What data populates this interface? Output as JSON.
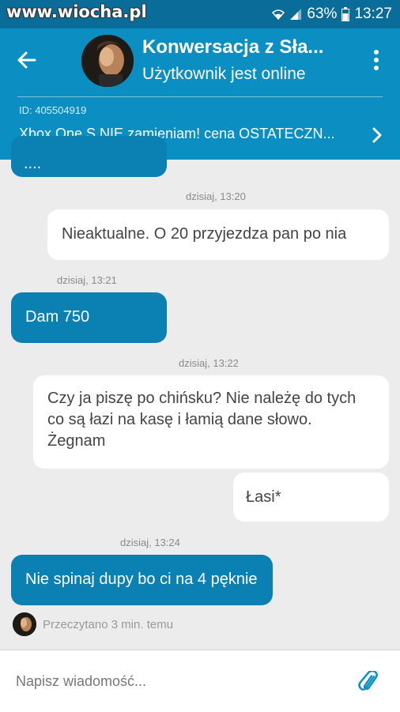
{
  "statusbar": {
    "watermark": "www.wiocha.pl",
    "battery": "63%",
    "time": "13:27"
  },
  "header": {
    "title": "Konwersacja z Sła...",
    "status": "Użytkownik jest online",
    "listing_id": "ID: 405504919",
    "listing_title": "Xbox One S NIE zamieniam! cena OSTATECZN..."
  },
  "messages": [
    {
      "type": "incoming",
      "text": "...."
    },
    {
      "type": "timestamp",
      "text": "dzisiaj, 13:20"
    },
    {
      "type": "outgoing",
      "text": "Nieaktualne. O 20 przyjezdza pan po nia"
    },
    {
      "type": "timestamp",
      "text": "dzisiaj, 13:21"
    },
    {
      "type": "incoming",
      "text": "Dam 750"
    },
    {
      "type": "timestamp",
      "text": "dzisiaj, 13:22"
    },
    {
      "type": "outgoing",
      "text": "Czy ja piszę po chińsku? Nie należę do tych co są łazi na kasę i łamią dane słowo. Żegnam"
    },
    {
      "type": "outgoing",
      "text": "Łasi*"
    },
    {
      "type": "timestamp",
      "text": "dzisiaj, 13:24"
    },
    {
      "type": "incoming",
      "text": "Nie spinaj dupy bo ci na 4 pęknie"
    }
  ],
  "read_receipt": "Przeczytano 3 min. temu",
  "composer": {
    "placeholder": "Napisz wiadomość..."
  },
  "icons": [
    "wifi-icon",
    "signal-icon",
    "battery-icon",
    "back-arrow-icon",
    "more-vert-icon",
    "chevron-right-icon",
    "paperclip-icon"
  ],
  "colors": {
    "header": "#0b8ec1",
    "statusbar": "#0a6d99",
    "incoming_bubble": "#0b80b3",
    "outgoing_bubble": "#ffffff",
    "background": "#ececec"
  }
}
